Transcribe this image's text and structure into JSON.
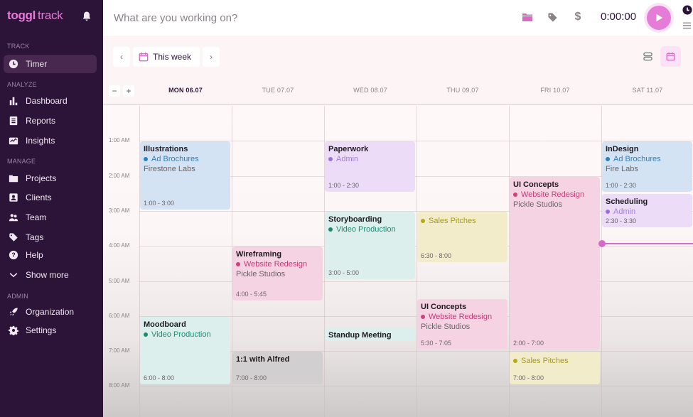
{
  "app": {
    "brand": "toggl",
    "product": "track"
  },
  "sidebar": {
    "sections": [
      {
        "label": "TRACK",
        "items": [
          {
            "label": "Timer",
            "icon": "clock-icon",
            "active": true
          }
        ]
      },
      {
        "label": "ANALYZE",
        "items": [
          {
            "label": "Dashboard",
            "icon": "bar-chart-icon"
          },
          {
            "label": "Reports",
            "icon": "document-icon"
          },
          {
            "label": "Insights",
            "icon": "insights-icon"
          }
        ]
      },
      {
        "label": "MANAGE",
        "items": [
          {
            "label": "Projects",
            "icon": "folder-icon"
          },
          {
            "label": "Clients",
            "icon": "client-card-icon"
          },
          {
            "label": "Team",
            "icon": "team-icon"
          },
          {
            "label": "Tags",
            "icon": "tag-icon"
          },
          {
            "label": "Help",
            "icon": "help-icon"
          },
          {
            "label": "Show more",
            "icon": "chevron-down-icon"
          }
        ]
      },
      {
        "label": "ADMIN",
        "items": [
          {
            "label": "Organization",
            "icon": "rocket-icon"
          },
          {
            "label": "Settings",
            "icon": "gear-icon"
          }
        ]
      }
    ]
  },
  "topbar": {
    "placeholder": "What are you working on?",
    "timer": "0:00:00"
  },
  "toolbar": {
    "week_label": "This week"
  },
  "calendar": {
    "days": [
      {
        "label": "MON 06.07",
        "today": true
      },
      {
        "label": "TUE 07.07",
        "today": false
      },
      {
        "label": "WED 08.07",
        "today": false
      },
      {
        "label": "THU 09.07",
        "today": false
      },
      {
        "label": "FRI 10.07",
        "today": false
      },
      {
        "label": "SAT 11.07",
        "today": false
      }
    ],
    "hours": [
      "1:00 AM",
      "2:00 AM",
      "3:00 AM",
      "4:00 AM",
      "5:00 AM",
      "6:00 AM",
      "7:00 AM",
      "8:00 AM"
    ],
    "now_hour": 4.0,
    "events": [
      {
        "day": 0,
        "start": 1.0,
        "end": 3.0,
        "title": "Illustrations",
        "project": "Ad Brochures",
        "client": "Firestone Labs",
        "time": "1:00 - 3:00",
        "color": "blue"
      },
      {
        "day": 0,
        "start": 6.0,
        "end": 8.0,
        "title": "Moodboard",
        "project": "Video Production",
        "client": "",
        "time": "6:00 - 8:00",
        "color": "teal"
      },
      {
        "day": 1,
        "start": 4.0,
        "end": 5.6,
        "title": "Wireframing",
        "project": "Website Redesign",
        "client": "Pickle Studios",
        "time": "4:00 - 5:45",
        "color": "pink"
      },
      {
        "day": 1,
        "start": 7.0,
        "end": 8.0,
        "title": "1:1 with Alfred",
        "project": "",
        "client": "",
        "time": "7:00 - 8:00",
        "color": "gray"
      },
      {
        "day": 2,
        "start": 1.0,
        "end": 2.5,
        "title": "Paperwork",
        "project": "Admin",
        "client": "",
        "time": "1:00 - 2:30",
        "color": "purple"
      },
      {
        "day": 2,
        "start": 3.0,
        "end": 5.0,
        "title": "Storyboarding",
        "project": "Video Production",
        "client": "",
        "time": "3:00 - 5:00",
        "color": "teal"
      },
      {
        "day": 2,
        "start": 6.3,
        "end": 6.75,
        "title": "Standup Meeting",
        "project": "",
        "client": "",
        "time": "",
        "color": "teal"
      },
      {
        "day": 3,
        "start": 3.0,
        "end": 4.5,
        "title": "",
        "project": "Sales Pitches",
        "client": "",
        "time": "6:30 - 8:00",
        "color": "yellow"
      },
      {
        "day": 3,
        "start": 5.5,
        "end": 7.0,
        "title": "UI Concepts",
        "project": "Website Redesign",
        "client": "Pickle Studios",
        "time": "5:30 - 7:05",
        "color": "pink"
      },
      {
        "day": 4,
        "start": 2.0,
        "end": 7.0,
        "title": "UI Concepts",
        "project": "Website Redesign",
        "client": "Pickle Studios",
        "time": "2:00 - 7:00",
        "color": "pink"
      },
      {
        "day": 4,
        "start": 7.0,
        "end": 8.0,
        "title": "",
        "project": "Sales Pitches",
        "client": "",
        "time": "7:00 - 8:00",
        "color": "yellow"
      },
      {
        "day": 5,
        "start": 1.0,
        "end": 2.5,
        "title": "InDesign",
        "project": "Ad Brochures",
        "client": "Fire Labs",
        "time": "1:00 - 2:30",
        "color": "blue"
      },
      {
        "day": 5,
        "start": 2.5,
        "end": 3.5,
        "title": "Scheduling",
        "project": "Admin",
        "client": "",
        "time": "2:30 - 3:30",
        "color": "purple"
      }
    ],
    "palette": {
      "blue": {
        "bg": "#d3e3f3",
        "fg": "#2e7fc0",
        "dot": "#2b7fc4"
      },
      "teal": {
        "bg": "#dcefed",
        "fg": "#1c8c73",
        "dot": "#1a8a6c"
      },
      "pink": {
        "bg": "#f5d3e3",
        "fg": "#c43b7a",
        "dot": "#d0407e"
      },
      "purple": {
        "bg": "#ecdcf8",
        "fg": "#a57be0",
        "dot": "#9c6fe0"
      },
      "yellow": {
        "bg": "#f3eccb",
        "fg": "#a49a1f",
        "dot": "#b5a81c"
      },
      "gray": {
        "bg": "#d2cfd0",
        "fg": "#555",
        "dot": "#777"
      }
    }
  }
}
